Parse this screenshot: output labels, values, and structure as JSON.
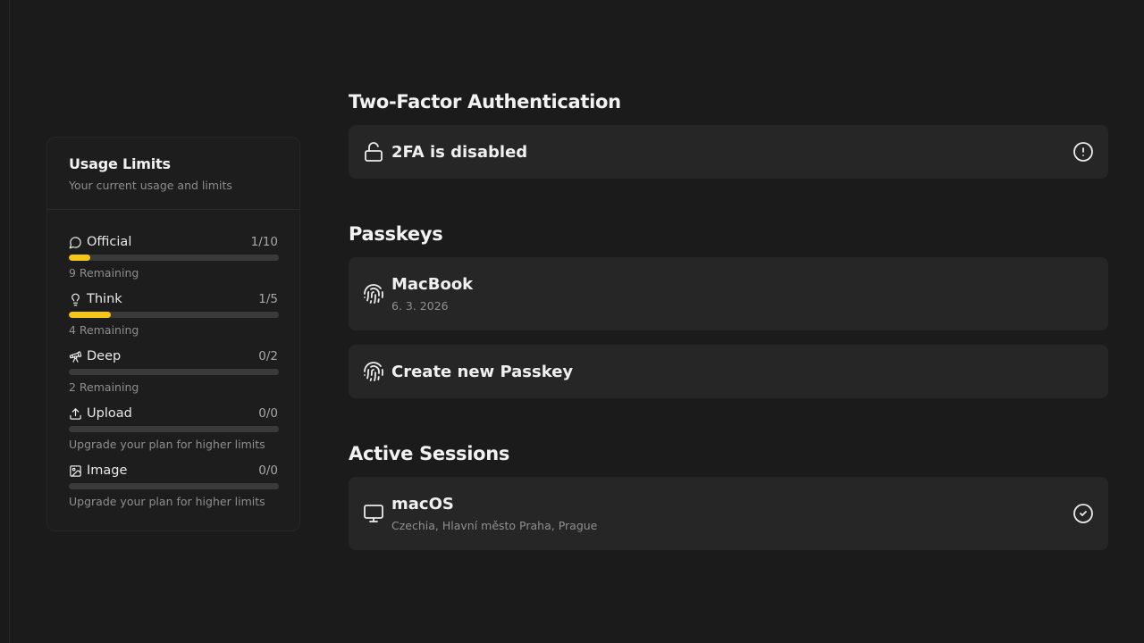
{
  "usage": {
    "title": "Usage Limits",
    "subtitle": "Your current usage and limits",
    "accent_color": "#f5c518",
    "items": [
      {
        "icon": "chat-bubble-icon",
        "label": "Official",
        "count": "1/10",
        "fill": 0.1,
        "note": "9 Remaining"
      },
      {
        "icon": "lightbulb-icon",
        "label": "Think",
        "count": "1/5",
        "fill": 0.2,
        "note": "4 Remaining"
      },
      {
        "icon": "telescope-icon",
        "label": "Deep",
        "count": "0/2",
        "fill": 0,
        "note": "2 Remaining"
      },
      {
        "icon": "upload-icon",
        "label": "Upload",
        "count": "0/0",
        "fill": 0,
        "note": "Upgrade your plan for higher limits"
      },
      {
        "icon": "image-icon",
        "label": "Image",
        "count": "0/0",
        "fill": 0,
        "note": "Upgrade your plan for higher limits"
      }
    ]
  },
  "two_factor": {
    "title": "Two-Factor Authentication",
    "status": "2FA is disabled",
    "lead_icon": "unlocked-padlock-icon",
    "trail_icon": "alert-circle-icon"
  },
  "passkeys": {
    "title": "Passkeys",
    "items": [
      {
        "name": "MacBook",
        "date": "6. 3. 2026",
        "icon": "fingerprint-icon"
      }
    ],
    "create_label": "Create new Passkey"
  },
  "sessions": {
    "title": "Active Sessions",
    "items": [
      {
        "os": "macOS",
        "location": "Czechia, Hlavní město Praha, Prague",
        "icon": "monitor-icon",
        "status_icon": "check-circle-icon"
      }
    ]
  }
}
